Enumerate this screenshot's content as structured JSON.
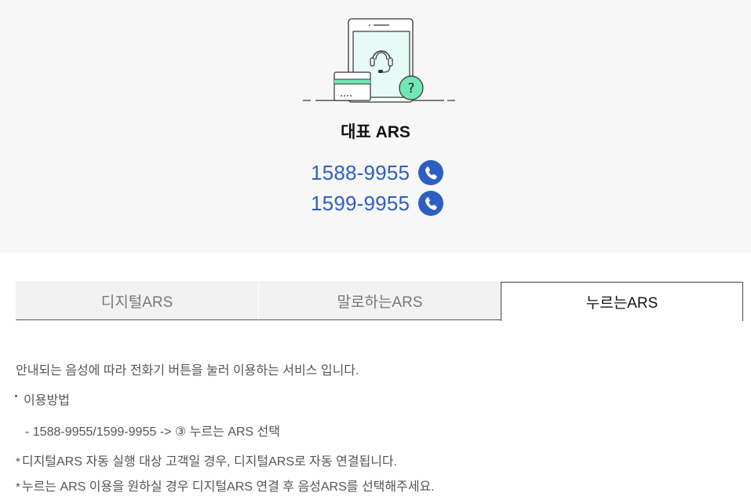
{
  "hero": {
    "title": "대표 ARS",
    "phones": [
      "1588-9955",
      "1599-9955"
    ],
    "icons": {
      "illustration": "customer-service-phone-illustration",
      "call": "phone-call-icon"
    },
    "colors": {
      "accent": "#2d5fc3",
      "mint": "#e6fbf6",
      "mint_strong": "#71e6b7"
    }
  },
  "tabs": {
    "items": [
      "디지털ARS",
      "말로하는ARS",
      "누르는ARS"
    ],
    "active": "누르는ARS"
  },
  "content": {
    "intro": "안내되는 음성에 따라 전화기 버튼을 눌러 이용하는 서비스 입니다.",
    "howto_label": "이용방법",
    "howto_detail": "- 1588-9955/1599-9955 -> ③ 누르는 ARS 선택",
    "star_mark": "*",
    "note1": "디지털ARS 자동 실행 대상 고객일 경우, 디지털ARS로 자동 연결됩니다.",
    "note2": "누르는 ARS 이용을 원하실 경우 디지털ARS 연결 후 음성ARS를 선택해주세요."
  }
}
